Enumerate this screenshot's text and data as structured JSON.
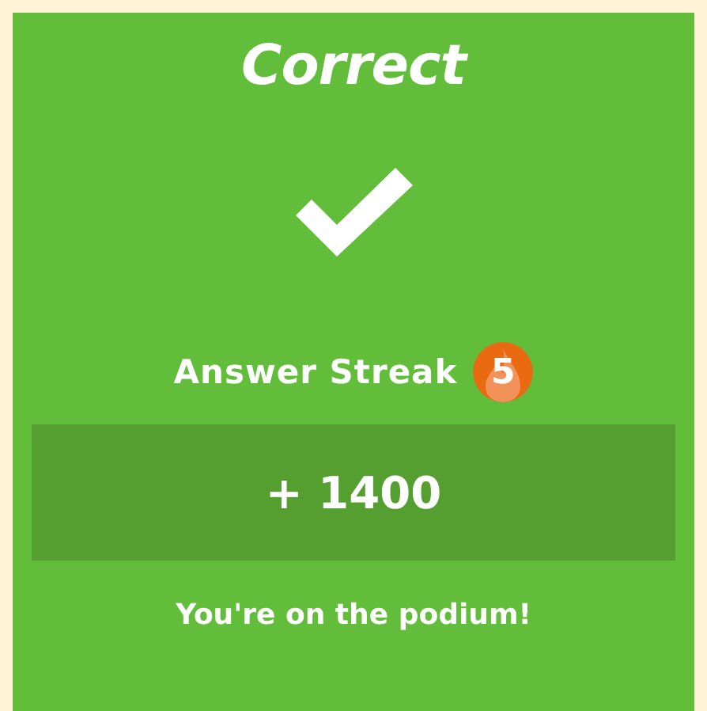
{
  "title": "Correct",
  "streak": {
    "label": "Answer Streak",
    "count": "5"
  },
  "score": "+ 1400",
  "message": "You're on the podium!"
}
